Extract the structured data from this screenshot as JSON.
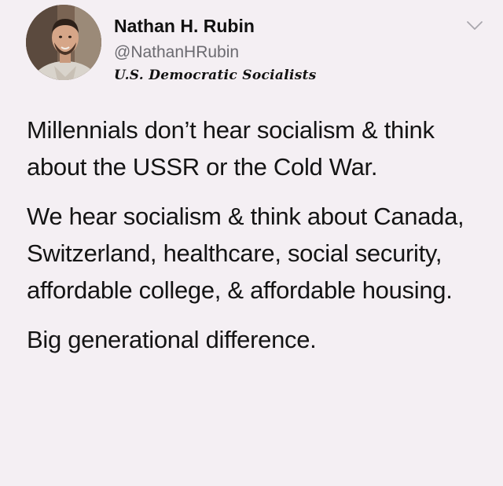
{
  "author": {
    "display_name": "Nathan H. Rubin",
    "handle": "@NathanHRubin",
    "bio_tag": "U.S. Democratic Socialists"
  },
  "menu_icon": "chevron-down-icon",
  "tweet": {
    "paragraphs": [
      "Millennials don’t hear socialism & think about the USSR or the Cold War.",
      "We hear socialism & think about Canada, Switzerland, healthcare, social security, affordable college, & affordable housing.",
      "Big generational difference."
    ]
  },
  "colors": {
    "background": "#f4eff3",
    "text": "#141414",
    "handle": "#6b6a70"
  }
}
